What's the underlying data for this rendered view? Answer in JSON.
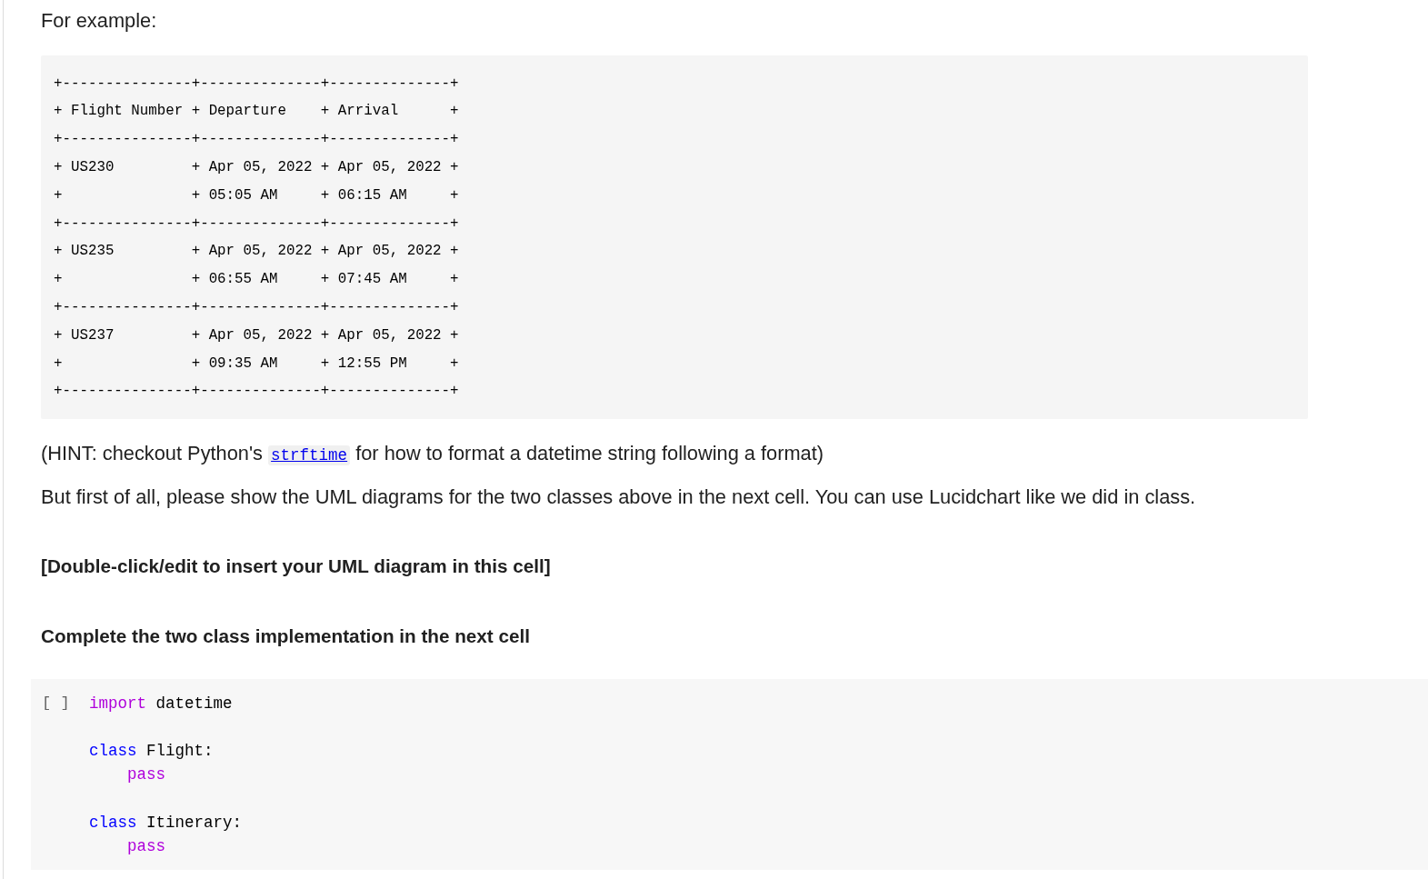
{
  "markdown_cell": {
    "intro": "For example:",
    "example_table_lines": [
      "+---------------+--------------+--------------+",
      "+ Flight Number + Departure    + Arrival      +",
      "+---------------+--------------+--------------+",
      "+ US230         + Apr 05, 2022 + Apr 05, 2022 +",
      "+               + 05:05 AM     + 06:15 AM     +",
      "+---------------+--------------+--------------+",
      "+ US235         + Apr 05, 2022 + Apr 05, 2022 +",
      "+               + 06:55 AM     + 07:45 AM     +",
      "+---------------+--------------+--------------+",
      "+ US237         + Apr 05, 2022 + Apr 05, 2022 +",
      "+               + 09:35 AM     + 12:55 PM     +",
      "+---------------+--------------+--------------+"
    ],
    "hint": {
      "before": "(HINT: checkout Python's",
      "link": "strftime",
      "after": "for how to format a datetime string following a format)"
    },
    "instruction": "But first of all, please show the UML diagrams for the two classes above in the next cell. You can use Lucidchart like we did in class.",
    "uml_placeholder": "[Double-click/edit to insert your UML diagram in this cell]",
    "heading": "Complete the two class implementation in the next cell"
  },
  "code_cell": {
    "run_indicator": "[ ]",
    "blocks": [
      [
        {
          "tokens": [
            {
              "text": "import",
              "kind": "control"
            },
            {
              "text": "datetime",
              "kind": "name"
            }
          ]
        }
      ],
      [
        {
          "tokens": [
            {
              "text": "class",
              "kind": "keyword"
            },
            {
              "text": "Flight:",
              "kind": "name"
            }
          ],
          "body": [
            {
              "tokens": [
                {
                  "text": "pass",
                  "kind": "control"
                }
              ]
            }
          ]
        }
      ],
      [
        {
          "tokens": [
            {
              "text": "class",
              "kind": "keyword"
            },
            {
              "text": "Itinerary:",
              "kind": "name"
            }
          ],
          "body": [
            {
              "tokens": [
                {
                  "text": "pass",
                  "kind": "control"
                }
              ]
            }
          ]
        }
      ]
    ]
  }
}
